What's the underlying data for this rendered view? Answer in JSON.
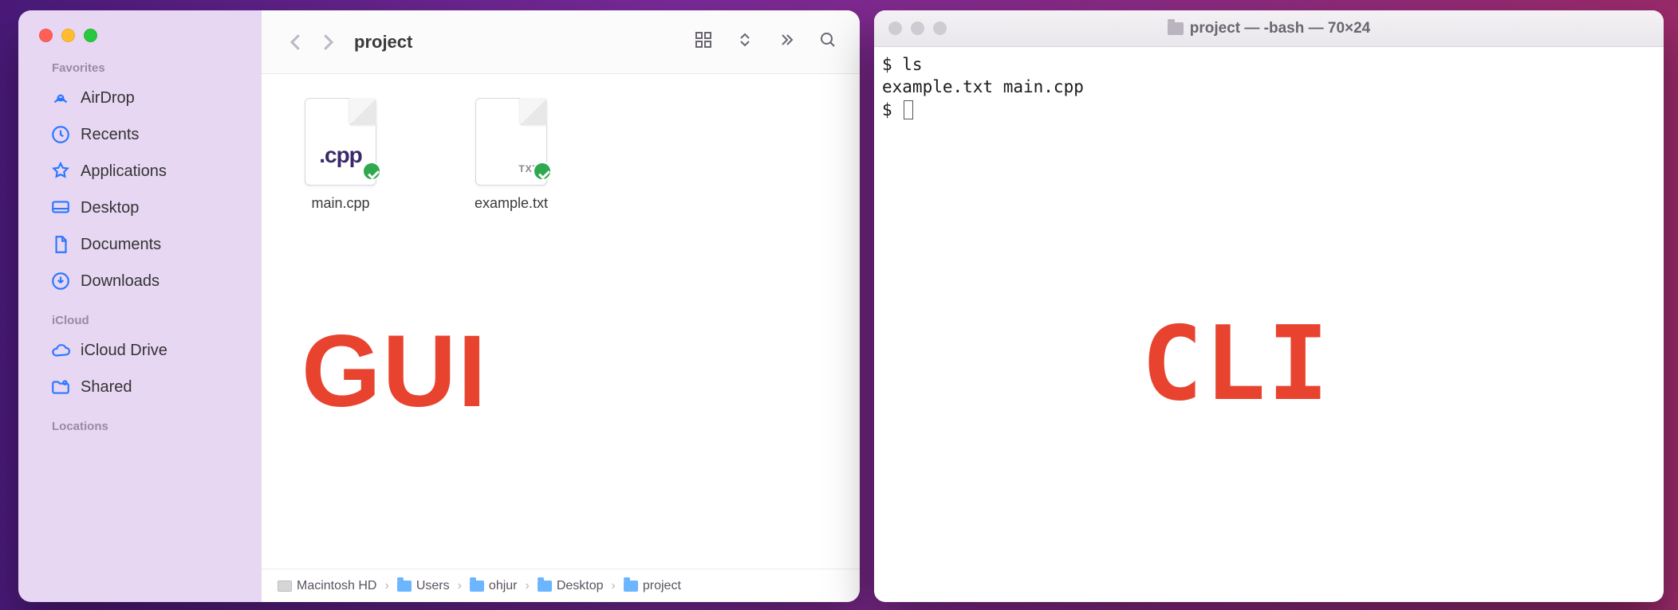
{
  "finder": {
    "title": "project",
    "sidebar": {
      "sections": [
        {
          "title": "Favorites",
          "items": [
            {
              "label": "AirDrop",
              "icon": "airdrop-icon"
            },
            {
              "label": "Recents",
              "icon": "clock-icon"
            },
            {
              "label": "Applications",
              "icon": "apps-icon"
            },
            {
              "label": "Desktop",
              "icon": "desktop-icon"
            },
            {
              "label": "Documents",
              "icon": "document-icon"
            },
            {
              "label": "Downloads",
              "icon": "download-icon"
            }
          ]
        },
        {
          "title": "iCloud",
          "items": [
            {
              "label": "iCloud Drive",
              "icon": "cloud-icon"
            },
            {
              "label": "Shared",
              "icon": "shared-folder-icon"
            }
          ]
        },
        {
          "title": "Locations",
          "items": []
        }
      ]
    },
    "files": [
      {
        "name": "main.cpp",
        "ext_label": ".cpp",
        "style": "big",
        "synced": true
      },
      {
        "name": "example.txt",
        "ext_label": "TXT",
        "style": "small",
        "synced": true
      }
    ],
    "path": [
      {
        "label": "Macintosh HD",
        "icon": "hd"
      },
      {
        "label": "Users",
        "icon": "folder"
      },
      {
        "label": "ohjur",
        "icon": "folder"
      },
      {
        "label": "Desktop",
        "icon": "folder"
      },
      {
        "label": "project",
        "icon": "folder"
      }
    ],
    "overlay_label": "GUI"
  },
  "terminal": {
    "title": "project — -bash — 70×24",
    "lines": [
      "$ ls",
      "example.txt main.cpp",
      "$ "
    ],
    "overlay_label": "CLI"
  }
}
